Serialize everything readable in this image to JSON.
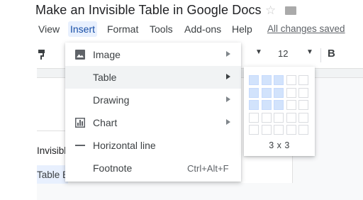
{
  "doc": {
    "title": "Make an Invisible Table in Google Docs",
    "saved_status": "All changes saved"
  },
  "menubar": {
    "items": [
      {
        "label": "View"
      },
      {
        "label": "Insert"
      },
      {
        "label": "Format"
      },
      {
        "label": "Tools"
      },
      {
        "label": "Add-ons"
      },
      {
        "label": "Help"
      }
    ],
    "active": "Insert"
  },
  "toolbar": {
    "font_size": "12",
    "bold_label": "B"
  },
  "document": {
    "text_line1": "Invisible",
    "text_line2": "Table Bor"
  },
  "insert_menu": {
    "items": [
      {
        "label": "Image",
        "icon": "image-icon",
        "has_submenu": true
      },
      {
        "label": "Table",
        "icon": "",
        "has_submenu": true
      },
      {
        "label": "Drawing",
        "icon": "",
        "has_submenu": true
      },
      {
        "label": "Chart",
        "icon": "chart-icon",
        "has_submenu": true
      },
      {
        "label": "Horizontal line",
        "icon": "horizontal-line-icon",
        "has_submenu": false
      },
      {
        "label": "Footnote",
        "icon": "",
        "has_submenu": false,
        "shortcut": "Ctrl+Alt+F"
      }
    ],
    "hovered": "Table"
  },
  "table_picker": {
    "rows": 5,
    "cols": 5,
    "selected_rows": 3,
    "selected_cols": 3,
    "size_label": "3 x 3"
  },
  "colors": {
    "accent": "#1a73e8",
    "active_menu_bg": "#e8f0fe",
    "selected_cell": "#d2e3fc"
  }
}
